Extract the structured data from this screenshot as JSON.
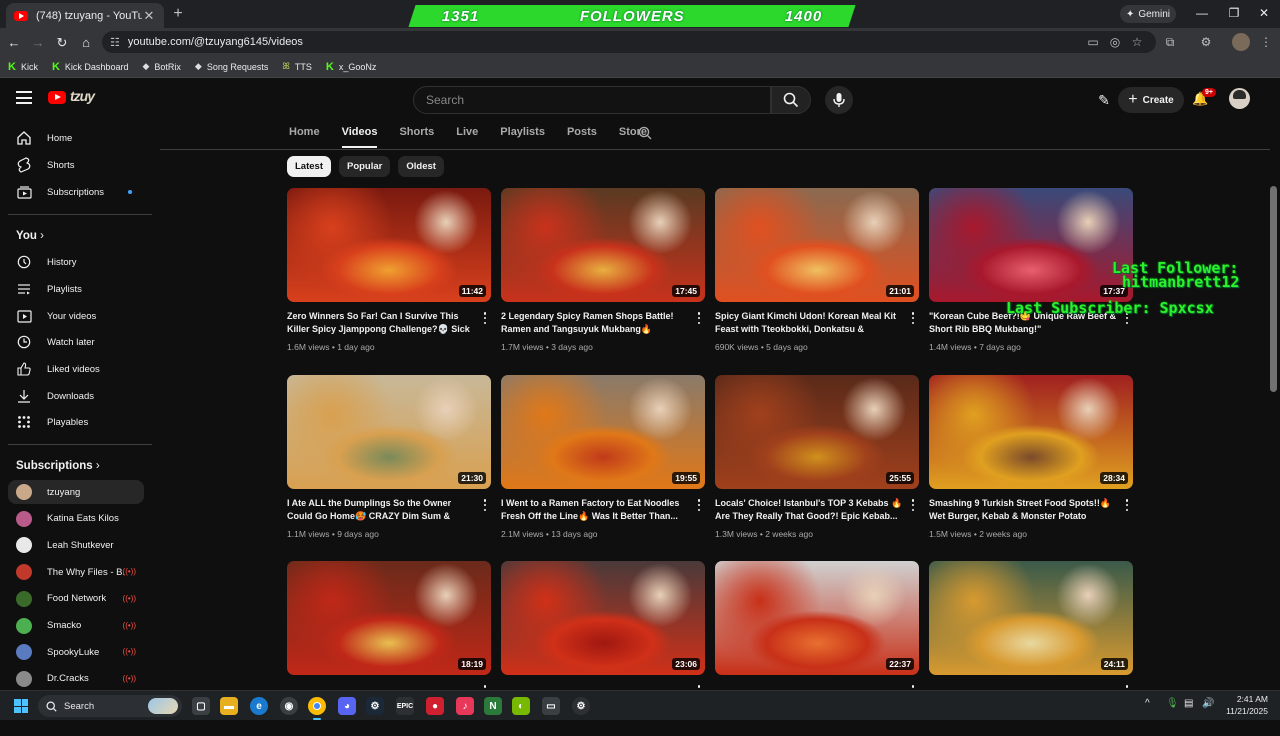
{
  "browser": {
    "tab_title": "(748) tzuyang - YouTube",
    "tab_close": "✕",
    "new_tab": "+",
    "url": "youtube.com/@tzuyang6145/videos",
    "gemini_label": "Gemini",
    "window_controls": [
      "—",
      "❐",
      "✕"
    ],
    "bookmarks": [
      {
        "label": "Kick",
        "icon": "kick-icon"
      },
      {
        "label": "Kick Dashboard",
        "icon": "kick-icon"
      },
      {
        "label": "BotRix",
        "icon": "botrix-icon"
      },
      {
        "label": "Song Requests",
        "icon": "song-icon"
      },
      {
        "label": "TTS",
        "icon": "tts-icon"
      },
      {
        "label": "x_GooNz",
        "icon": "kick-icon"
      }
    ]
  },
  "stream_overlay": {
    "banner_left": "1351",
    "banner_center": "FOLLOWERS",
    "banner_right": "1400",
    "last_follower": "Last Follower:",
    "last_follower_name": "hitmanbrett12",
    "last_subscriber": "Last Subscriber: Spxcsx"
  },
  "masthead": {
    "logo_text": "tzuy",
    "search_placeholder": "Search",
    "create_label": "Create",
    "notification_count": "9+"
  },
  "sidebar": {
    "main": [
      {
        "label": "Home",
        "icon": "home-icon"
      },
      {
        "label": "Shorts",
        "icon": "shorts-icon"
      },
      {
        "label": "Subscriptions",
        "icon": "subscriptions-icon"
      }
    ],
    "you_header": "You",
    "you_items": [
      {
        "label": "History",
        "icon": "history-icon"
      },
      {
        "label": "Playlists",
        "icon": "playlists-icon"
      },
      {
        "label": "Your videos",
        "icon": "your-videos-icon"
      },
      {
        "label": "Watch later",
        "icon": "watch-later-icon"
      },
      {
        "label": "Liked videos",
        "icon": "liked-videos-icon"
      },
      {
        "label": "Downloads",
        "icon": "downloads-icon"
      },
      {
        "label": "Playables",
        "icon": "playables-icon"
      }
    ],
    "subs_header": "Subscriptions",
    "subscriptions": [
      {
        "label": "tzuyang",
        "color": "#c9a98a",
        "live": false
      },
      {
        "label": "Katina Eats Kilos",
        "color": "#b85a8a",
        "live": false
      },
      {
        "label": "Leah Shutkever",
        "color": "#e8e8e8",
        "live": false
      },
      {
        "label": "The Why Files - B...",
        "color": "#c0392b",
        "live": true
      },
      {
        "label": "Food Network",
        "color": "#3a6a2a",
        "live": true
      },
      {
        "label": "Smacko",
        "color": "#4caf50",
        "live": true
      },
      {
        "label": "SpookyLuke",
        "color": "#5a7bbf",
        "live": true
      },
      {
        "label": "Dr.Cracks",
        "color": "#8a8a8a",
        "live": true
      }
    ]
  },
  "channel_tabs": [
    "Home",
    "Videos",
    "Shorts",
    "Live",
    "Playlists",
    "Posts",
    "Store"
  ],
  "active_tab": "Videos",
  "sort_chips": [
    "Latest",
    "Popular",
    "Oldest"
  ],
  "videos": [
    {
      "title": "Zero Winners So Far! Can I Survive This Killer Spicy Jjamppong Challenge?💀 Sick for a...",
      "views": "1.6M views",
      "age": "1 day ago",
      "duration": "11:42",
      "colors": [
        "#7a1a10",
        "#d8401c",
        "#f0a030"
      ]
    },
    {
      "title": "2 Legendary Spicy Ramen Shops Battle! Ramen and Tangsuyuk Mukbang🔥",
      "views": "1.7M views",
      "age": "3 days ago",
      "duration": "17:45",
      "colors": [
        "#5a3a22",
        "#c8321c",
        "#e8b040"
      ]
    },
    {
      "title": "Spicy Giant Kimchi Udon! Korean Meal Kit Feast with Tteokbokki, Donkatsu & Japcha...",
      "views": "690K views",
      "age": "5 days ago",
      "duration": "21:01",
      "colors": [
        "#8a6a50",
        "#e05020",
        "#f0c060"
      ]
    },
    {
      "title": "\"Korean Cube Beef?!😋 Unique Raw Beef & Short Rib BBQ Mukbang!\"",
      "views": "1.4M views",
      "age": "7 days ago",
      "duration": "17:37",
      "colors": [
        "#3a4a7a",
        "#a8182c",
        "#e86070"
      ]
    },
    {
      "title": "I Ate ALL the Dumplings So the Owner Could Go Home🥵 CRAZY Dim Sum & Chinese...",
      "views": "1.1M views",
      "age": "9 days ago",
      "duration": "21:30",
      "colors": [
        "#c8b898",
        "#d8a050",
        "#7a8a5a"
      ]
    },
    {
      "title": "I Went to a Ramen Factory to Eat Noodles Fresh Off the Line🔥 Was It Better Than...",
      "views": "2.1M views",
      "age": "13 days ago",
      "duration": "19:55",
      "colors": [
        "#8a7a6a",
        "#e07818",
        "#c03a1a"
      ]
    },
    {
      "title": "Locals' Choice! Istanbul's TOP 3 Kebabs 🔥 Are They Really That Good?! Epic Kebab...",
      "views": "1.3M views",
      "age": "2 weeks ago",
      "duration": "25:55",
      "colors": [
        "#5a2a1a",
        "#a0401c",
        "#d0901c"
      ]
    },
    {
      "title": "Smashing 9 Turkish Street Food Spots!!🔥 Wet Burger, Kebab & Monster Potato Desse...",
      "views": "1.5M views",
      "age": "2 weeks ago",
      "duration": "28:34",
      "colors": [
        "#a02020",
        "#e0a020",
        "#7a4a2a"
      ]
    },
    {
      "title": "",
      "views": "",
      "age": "",
      "duration": "18:19",
      "colors": [
        "#6a2a1a",
        "#c02818",
        "#e8c050"
      ]
    },
    {
      "title": "",
      "views": "",
      "age": "",
      "duration": "23:06",
      "colors": [
        "#4a3a3a",
        "#d03018",
        "#a01810"
      ]
    },
    {
      "title": "",
      "views": "",
      "age": "",
      "duration": "22:37",
      "colors": [
        "#d0d0d0",
        "#c83018",
        "#e87030"
      ]
    },
    {
      "title": "",
      "views": "",
      "age": "",
      "duration": "24:11",
      "colors": [
        "#3a5a4a",
        "#d89a30",
        "#e8d8a0"
      ]
    }
  ],
  "taskbar": {
    "search_label": "Search",
    "clock_time": "2:41 AM",
    "clock_date": "11/21/2025"
  }
}
